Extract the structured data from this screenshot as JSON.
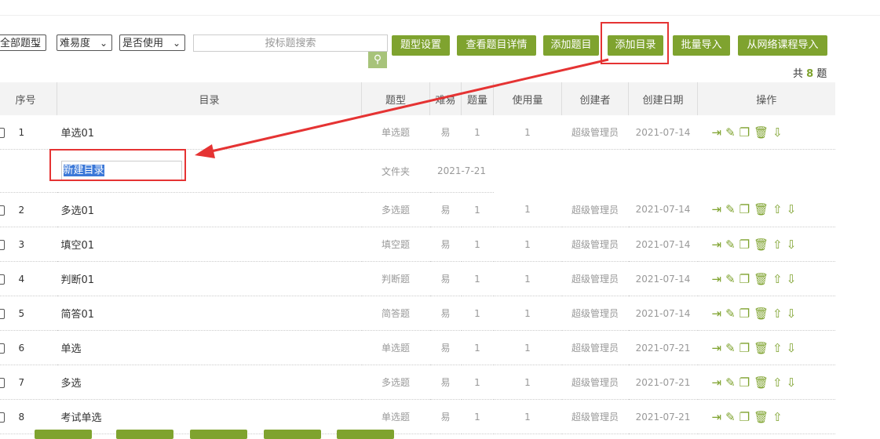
{
  "filters": {
    "type": "全部题型",
    "difficulty": "难易度",
    "used": "是否使用",
    "search_placeholder": "按标题搜索"
  },
  "toolbar": [
    "题型设置",
    "查看题目详情",
    "添加题目",
    "添加目录",
    "批量导入",
    "从网络课程导入"
  ],
  "total": {
    "prefix": "共",
    "count": "8",
    "suffix": "题"
  },
  "columns": [
    "序号",
    "目录",
    "题型",
    "难易",
    "题量",
    "使用量",
    "创建者",
    "创建日期",
    "操作"
  ],
  "rows": [
    {
      "seq": "1",
      "name": "单选01",
      "type": "单选题",
      "diff": "易",
      "count": "1",
      "used": "1",
      "creator": "超级管理员",
      "date": "2021-07-14",
      "ops": "⇥✎❐🗑⇩"
    },
    {
      "folder": true,
      "name": "新建目录",
      "type": "文件夹",
      "date": "2021-7-21"
    },
    {
      "seq": "2",
      "name": "多选01",
      "type": "多选题",
      "diff": "易",
      "count": "1",
      "used": "1",
      "creator": "超级管理员",
      "date": "2021-07-14",
      "ops": "⇥✎❐🗑⇧⇩"
    },
    {
      "seq": "3",
      "name": "填空01",
      "type": "填空题",
      "diff": "易",
      "count": "1",
      "used": "1",
      "creator": "超级管理员",
      "date": "2021-07-14",
      "ops": "⇥✎❐🗑⇧⇩"
    },
    {
      "seq": "4",
      "name": "判断01",
      "type": "判断题",
      "diff": "易",
      "count": "1",
      "used": "1",
      "creator": "超级管理员",
      "date": "2021-07-14",
      "ops": "⇥✎❐🗑⇧⇩"
    },
    {
      "seq": "5",
      "name": "简答01",
      "type": "简答题",
      "diff": "易",
      "count": "1",
      "used": "1",
      "creator": "超级管理员",
      "date": "2021-07-14",
      "ops": "⇥✎❐🗑⇧⇩"
    },
    {
      "seq": "6",
      "name": "单选",
      "type": "单选题",
      "diff": "易",
      "count": "1",
      "used": "1",
      "creator": "超级管理员",
      "date": "2021-07-21",
      "ops": "⇥✎❐🗑⇧⇩"
    },
    {
      "seq": "7",
      "name": "多选",
      "type": "多选题",
      "diff": "易",
      "count": "1",
      "used": "1",
      "creator": "超级管理员",
      "date": "2021-07-21",
      "ops": "⇥✎❐🗑⇧⇩"
    },
    {
      "seq": "8",
      "name": "考试单选",
      "type": "单选题",
      "diff": "易",
      "count": "1",
      "used": "1",
      "creator": "超级管理员",
      "date": "2021-07-21",
      "ops": "⇥✎❐🗑⇧"
    }
  ],
  "colors": {
    "accent": "#7fa32f",
    "highlight": "#e53333"
  }
}
